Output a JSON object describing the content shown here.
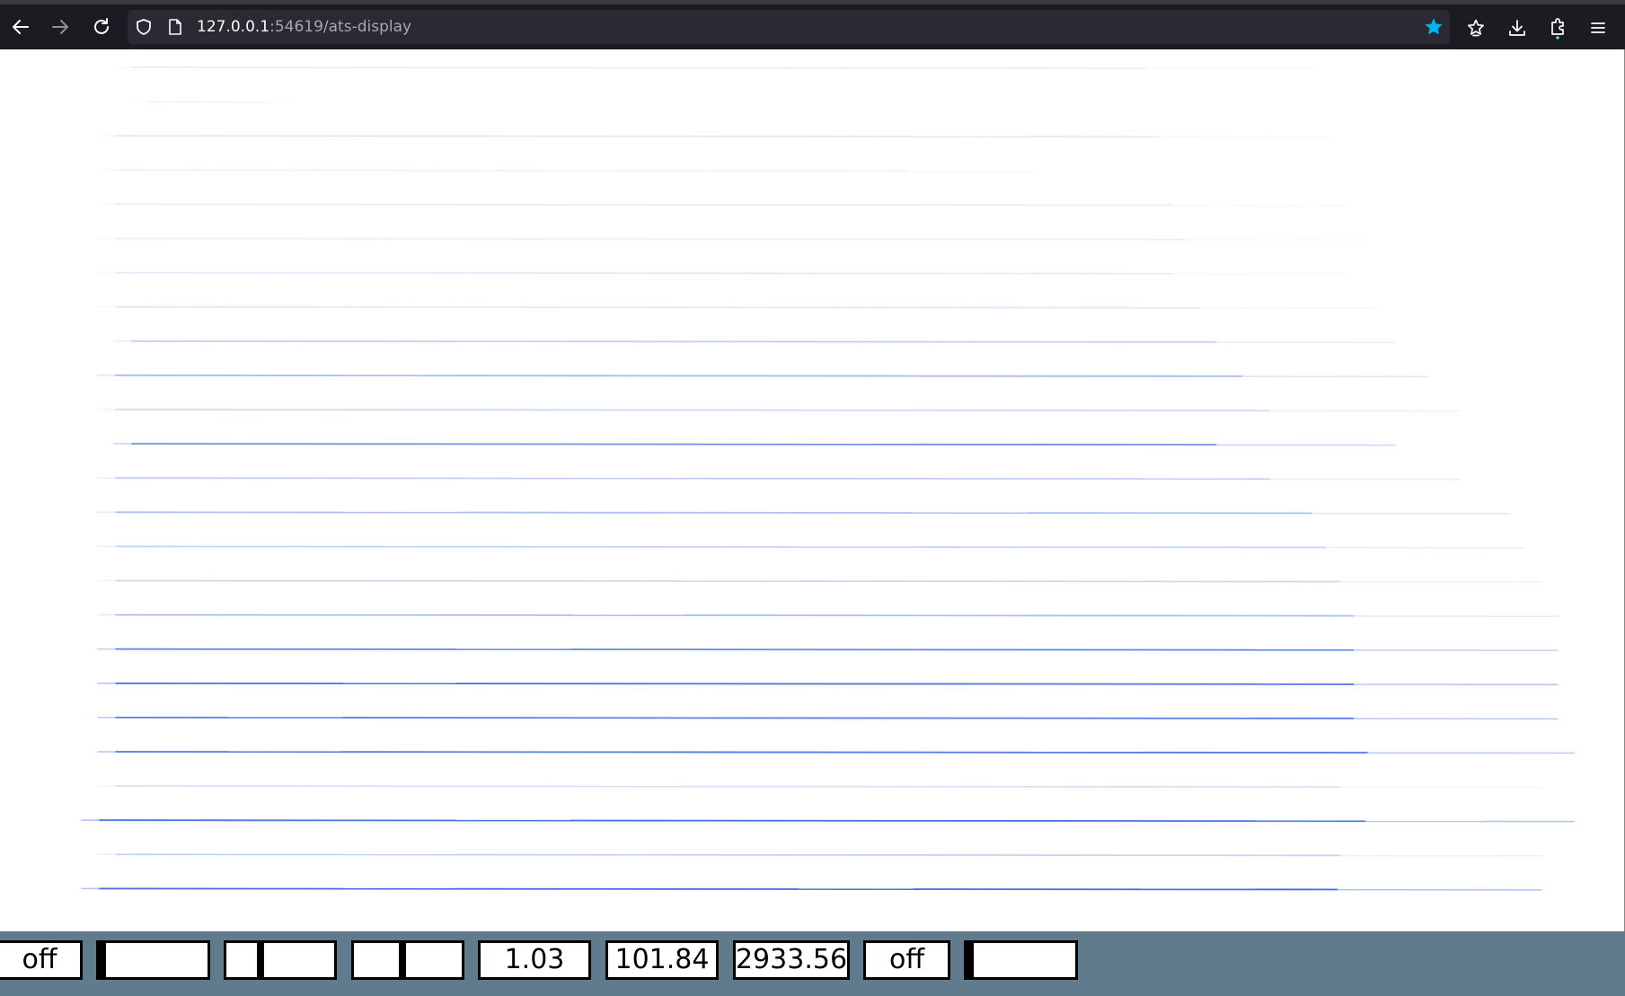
{
  "browser": {
    "url_host": "127.0.0.1",
    "url_rest": ":54619/ats-display",
    "bookmark_star_color": "#00b3f4",
    "toolbar_bg": "#1c1b22",
    "urlbar_bg": "#2b2a33"
  },
  "display": {
    "partial_line_color": "#2f5ee0",
    "background": "#ffffff",
    "partial_tracks": [
      {
        "start": 0.07,
        "end": 0.81,
        "intensity": 0.08
      },
      {
        "start": 0.08,
        "end": 0.18,
        "intensity": 0.06
      },
      {
        "start": 0.06,
        "end": 0.82,
        "intensity": 0.1
      },
      {
        "start": 0.06,
        "end": 0.64,
        "intensity": 0.06
      },
      {
        "start": 0.06,
        "end": 0.83,
        "intensity": 0.08
      },
      {
        "start": 0.06,
        "end": 0.84,
        "intensity": 0.07
      },
      {
        "start": 0.06,
        "end": 0.83,
        "intensity": 0.09
      },
      {
        "start": 0.06,
        "end": 0.85,
        "intensity": 0.1
      },
      {
        "start": 0.07,
        "end": 0.86,
        "intensity": 0.22
      },
      {
        "start": 0.06,
        "end": 0.88,
        "intensity": 0.33
      },
      {
        "start": 0.06,
        "end": 0.9,
        "intensity": 0.18
      },
      {
        "start": 0.07,
        "end": 0.86,
        "intensity": 0.58
      },
      {
        "start": 0.06,
        "end": 0.9,
        "intensity": 0.22
      },
      {
        "start": 0.06,
        "end": 0.93,
        "intensity": 0.3
      },
      {
        "start": 0.06,
        "end": 0.94,
        "intensity": 0.2
      },
      {
        "start": 0.06,
        "end": 0.95,
        "intensity": 0.18
      },
      {
        "start": 0.06,
        "end": 0.96,
        "intensity": 0.3
      },
      {
        "start": 0.06,
        "end": 0.96,
        "intensity": 0.62
      },
      {
        "start": 0.06,
        "end": 0.96,
        "intensity": 0.78
      },
      {
        "start": 0.06,
        "end": 0.96,
        "intensity": 0.7
      },
      {
        "start": 0.06,
        "end": 0.97,
        "intensity": 0.74
      },
      {
        "start": 0.06,
        "end": 0.95,
        "intensity": 0.14
      },
      {
        "start": 0.05,
        "end": 0.97,
        "intensity": 0.8
      },
      {
        "start": 0.06,
        "end": 0.95,
        "intensity": 0.2
      },
      {
        "start": 0.05,
        "end": 0.95,
        "intensity": 0.82
      }
    ]
  },
  "controls": [
    {
      "kind": "toggle",
      "label": "off"
    },
    {
      "kind": "slider",
      "value": 0.0
    },
    {
      "kind": "slider",
      "value": 0.3
    },
    {
      "kind": "slider",
      "value": 0.45
    },
    {
      "kind": "number",
      "label": "1.03"
    },
    {
      "kind": "number",
      "label": "101.84"
    },
    {
      "kind": "number",
      "label": "2933.56"
    },
    {
      "kind": "toggle",
      "label": "off"
    },
    {
      "kind": "slider",
      "value": 0.0
    }
  ]
}
